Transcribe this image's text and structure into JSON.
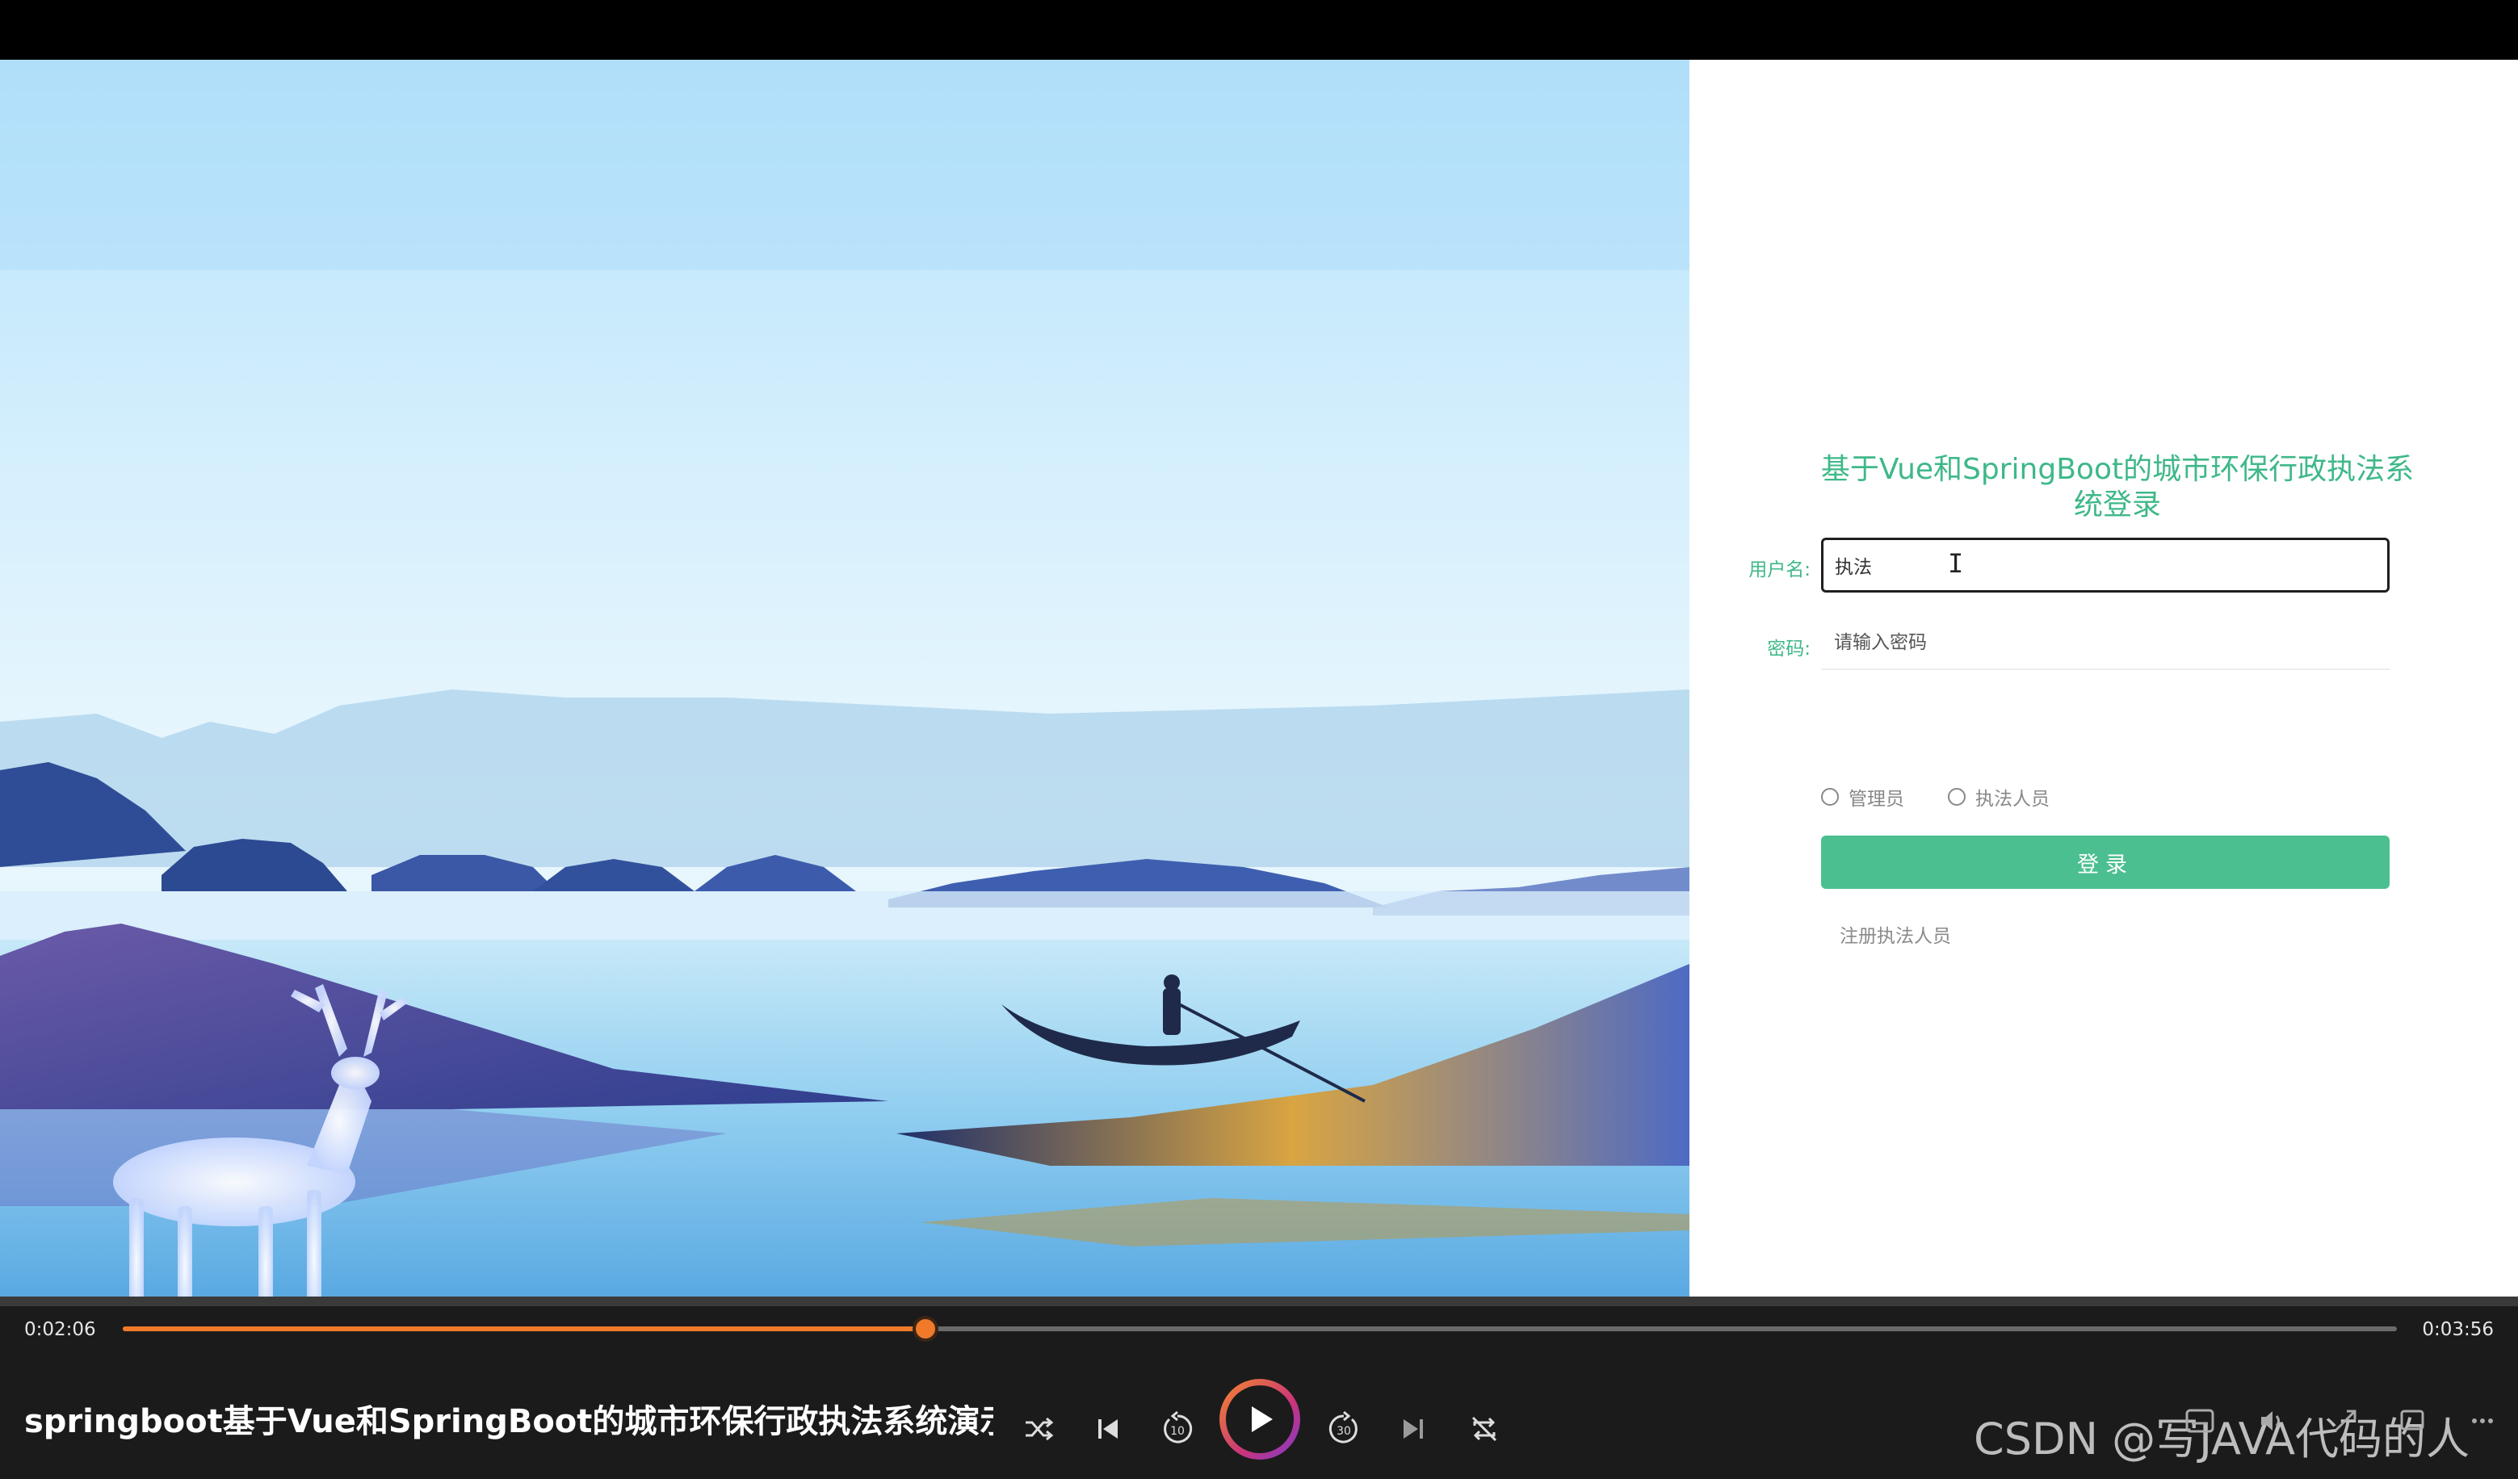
{
  "login": {
    "title": "基于Vue和SpringBoot的城市环保行政执法系统登录",
    "username_label": "用户名:",
    "username_value": "执法",
    "password_label": "密码:",
    "password_placeholder": "请输入密码",
    "roles": [
      "管理员",
      "执法人员"
    ],
    "login_button": "登录",
    "register_link": "注册执法人员",
    "accent_color": "#3fb888"
  },
  "player": {
    "current_time": "0:02:06",
    "total_time": "0:03:56",
    "progress_fraction": 0.353,
    "video_title": "springboot基于Vue和SpringBoot的城市环保行政执法系统演示...",
    "seek_color": "#f07a2a",
    "controls": [
      "shuffle-icon",
      "previous-icon",
      "rewind-10-icon",
      "play-icon",
      "forward-30-icon",
      "next-icon",
      "repeat-off-icon",
      "subtitles-icon",
      "volume-icon",
      "fullscreen-icon",
      "miniplayer-icon",
      "more-icon"
    ],
    "rewind_label": "10",
    "forward_label": "30"
  },
  "watermark": "CSDN @写JAVA代码的人"
}
